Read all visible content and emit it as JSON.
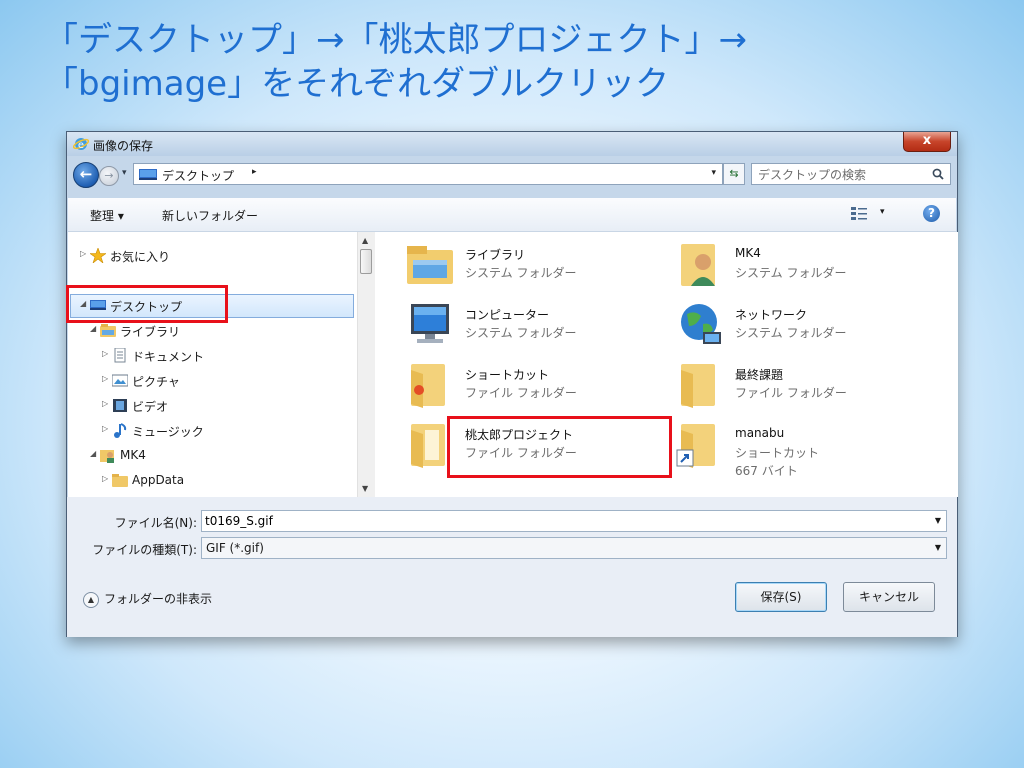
{
  "slide": {
    "title_line1": "「デスクトップ」→「桃太郎プロジェクト」→",
    "title_line2": "「bgimage」をそれぞれダブルクリック"
  },
  "dialog": {
    "title": "画像の保存",
    "close_label": "x",
    "address": {
      "location": "デスクトップ",
      "arrow": "▸",
      "dropdown": "▾"
    },
    "search": {
      "placeholder": "デスクトップの検索"
    },
    "toolbar": {
      "organize": "整理 ▾",
      "new_folder": "新しいフォルダー",
      "view_dropdown": "▾",
      "help": "?"
    },
    "nav_tree": [
      {
        "label": "お気に入り",
        "expander": "▷",
        "icon": "star-icon"
      },
      {
        "label": "デスクトップ",
        "expander": "◢",
        "icon": "desktop-icon",
        "selected": true
      },
      {
        "label": "ライブラリ",
        "expander": "◢",
        "icon": "library-icon"
      },
      {
        "label": "ドキュメント",
        "expander": "▷",
        "icon": "document-icon"
      },
      {
        "label": "ピクチャ",
        "expander": "▷",
        "icon": "picture-icon"
      },
      {
        "label": "ビデオ",
        "expander": "▷",
        "icon": "video-icon"
      },
      {
        "label": "ミュージック",
        "expander": "▷",
        "icon": "music-icon"
      },
      {
        "label": "MK4",
        "expander": "◢",
        "icon": "user-folder-icon"
      },
      {
        "label": "AppData",
        "expander": "▷",
        "icon": "folder-icon"
      }
    ],
    "files": [
      {
        "name": "ライブラリ",
        "type": "システム フォルダー",
        "icon": "library-folder-icon"
      },
      {
        "name": "MK4",
        "type": "システム フォルダー",
        "icon": "user-folder-icon"
      },
      {
        "name": "コンピューター",
        "type": "システム フォルダー",
        "icon": "computer-icon"
      },
      {
        "name": "ネットワーク",
        "type": "システム フォルダー",
        "icon": "network-icon"
      },
      {
        "name": "ショートカット",
        "type": "ファイル フォルダー",
        "icon": "folder-icon"
      },
      {
        "name": "最終課題",
        "type": "ファイル フォルダー",
        "icon": "folder-icon"
      },
      {
        "name": "桃太郎プロジェクト",
        "type": "ファイル フォルダー",
        "icon": "folder-icon",
        "highlighted": true
      },
      {
        "name": "manabu",
        "type": "ショートカット",
        "size": "667 バイト",
        "icon": "shortcut-folder-icon"
      }
    ],
    "form": {
      "filename_label": "ファイル名(N):",
      "filename_value": "t0169_S.gif",
      "filetype_label": "ファイルの種類(T):",
      "filetype_value": "GIF (*.gif)",
      "hide_folders": "フォルダーの非表示",
      "save_button": "保存(S)",
      "cancel_button": "キャンセル"
    },
    "colors": {
      "highlight_red": "#e8101a",
      "title_blue": "#1f6fd1"
    }
  }
}
